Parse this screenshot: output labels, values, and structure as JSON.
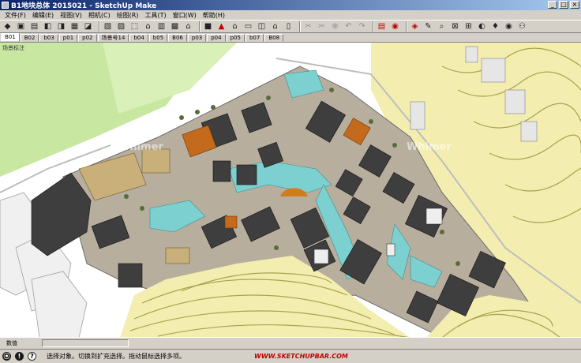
{
  "window": {
    "title": "B1地块总体 2015021 - SketchUp Make",
    "controls": [
      "_",
      "□",
      "×"
    ]
  },
  "menu": [
    "文件(F)",
    "编辑(E)",
    "视图(V)",
    "相机(C)",
    "绘图(R)",
    "工具(T)",
    "窗口(W)",
    "帮助(H)"
  ],
  "toolbar": [
    "new-icon",
    "open-icon",
    "save-icon",
    "cut-icon",
    "copy-icon",
    "paste-icon",
    "erase-icon",
    "sep",
    "xray-icon",
    "back-edges-icon",
    "wireframe-icon",
    "hidden-line-icon",
    "shaded-icon",
    "textured-icon",
    "monochrome-icon",
    "sep",
    "component-icon",
    "open-folder-icon",
    "home-icon",
    "front-view-icon",
    "right-view-icon",
    "back-view-icon",
    "left-view-icon",
    "sep",
    "follow-me-icon",
    "offset-icon",
    "erase-gray-icon",
    "undo-icon",
    "redo-icon",
    "sep",
    "print-icon",
    "model-info-icon",
    "sep",
    "section-plane-icon",
    "paint-icon",
    "zoom-icon",
    "zoom-window-icon",
    "zoom-extents-icon",
    "previous-view-icon",
    "position-camera-icon",
    "look-around-icon",
    "walk-icon"
  ],
  "tabs": [
    "B01",
    "B02",
    "b03",
    "p01",
    "p02",
    "场景号14",
    "b04",
    "b05",
    "B06",
    "p03",
    "p04",
    "p05",
    "b07",
    "B08"
  ],
  "active_tab": "B01",
  "viewport": {
    "scene_label": "场景标注",
    "watermark_left": "Whimer",
    "watermark_right": "Whimer"
  },
  "measurements": {
    "label": "数值",
    "value": ""
  },
  "status": {
    "icons": [
      "geo-location-icon",
      "credits-icon",
      "help-icon"
    ],
    "text": "选择对象。切换到扩充选择。拖动鼠标选择多项。",
    "brand": "WWW.SKETCHUPBAR.COM"
  },
  "colors": {
    "title_bar": "#0a246a",
    "terrain": "#f3eeb0",
    "contour": "#a9a34c",
    "green": "#c8e7a0",
    "water": "#7cd1d0",
    "roof_dark": "#3e3e3e",
    "roof_orange": "#c46a1c",
    "plaza": "#b8ae9e"
  }
}
